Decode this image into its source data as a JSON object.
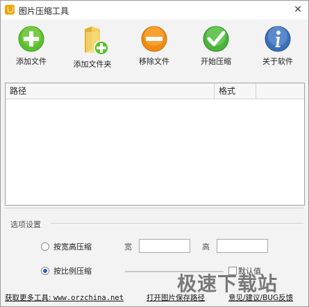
{
  "window": {
    "title": "图片压缩工具",
    "close_glyph": "✕"
  },
  "toolbar": {
    "items": [
      {
        "label": "添加文件",
        "icon": "add-circle-icon",
        "color": "#5dbf2f"
      },
      {
        "label": "添加文件夹",
        "icon": "add-folder-icon",
        "color": "#f0c84a"
      },
      {
        "label": "移除文件",
        "icon": "remove-circle-icon",
        "color": "#f08a12"
      },
      {
        "label": "开始压缩",
        "icon": "check-circle-icon",
        "color": "#49b33c"
      },
      {
        "label": "关于软件",
        "icon": "info-circle-icon",
        "color": "#3b6fb8"
      }
    ]
  },
  "file_list": {
    "columns": [
      "路径",
      "格式"
    ],
    "rows": []
  },
  "options": {
    "legend": "选项设置",
    "by_size": {
      "label": "按宽高压缩",
      "width_label": "宽",
      "height_label": "高",
      "width_value": "",
      "height_value": "",
      "selected": false
    },
    "by_ratio": {
      "label": "按比例压缩",
      "selected": true,
      "default_label": "默认值"
    }
  },
  "footer": {
    "more_tools": "获取更多工具:",
    "site": "www.orzchina.net",
    "open_save_path": "打开图片保存路径",
    "feedback": "意见/建议/BUG反馈"
  },
  "watermark": "极速下载站"
}
